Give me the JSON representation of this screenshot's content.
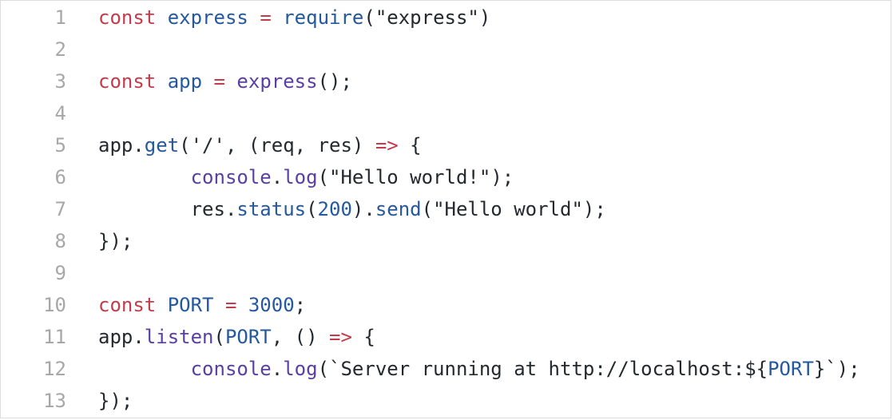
{
  "editor": {
    "lines": [
      {
        "number": "1",
        "tokens": [
          {
            "t": "kw",
            "v": "const"
          },
          {
            "t": "plain",
            "v": " "
          },
          {
            "t": "var",
            "v": "express"
          },
          {
            "t": "plain",
            "v": " "
          },
          {
            "t": "op",
            "v": "="
          },
          {
            "t": "plain",
            "v": " "
          },
          {
            "t": "var",
            "v": "require"
          },
          {
            "t": "plain",
            "v": "("
          },
          {
            "t": "str",
            "v": "\"express\""
          },
          {
            "t": "plain",
            "v": ")"
          }
        ]
      },
      {
        "number": "2",
        "tokens": []
      },
      {
        "number": "3",
        "tokens": [
          {
            "t": "kw",
            "v": "const"
          },
          {
            "t": "plain",
            "v": " "
          },
          {
            "t": "var",
            "v": "app"
          },
          {
            "t": "plain",
            "v": " "
          },
          {
            "t": "op",
            "v": "="
          },
          {
            "t": "plain",
            "v": " "
          },
          {
            "t": "func",
            "v": "express"
          },
          {
            "t": "plain",
            "v": "();"
          }
        ]
      },
      {
        "number": "4",
        "tokens": []
      },
      {
        "number": "5",
        "tokens": [
          {
            "t": "plain",
            "v": "app."
          },
          {
            "t": "prop",
            "v": "get"
          },
          {
            "t": "plain",
            "v": "("
          },
          {
            "t": "str",
            "v": "'/'"
          },
          {
            "t": "plain",
            "v": ", (req, res) "
          },
          {
            "t": "op",
            "v": "=>"
          },
          {
            "t": "plain",
            "v": " {"
          }
        ]
      },
      {
        "number": "6",
        "tokens": [
          {
            "t": "plain",
            "v": "        "
          },
          {
            "t": "func",
            "v": "console"
          },
          {
            "t": "plain",
            "v": "."
          },
          {
            "t": "func",
            "v": "log"
          },
          {
            "t": "plain",
            "v": "("
          },
          {
            "t": "str",
            "v": "\"Hello world!\""
          },
          {
            "t": "plain",
            "v": ");"
          }
        ]
      },
      {
        "number": "7",
        "tokens": [
          {
            "t": "plain",
            "v": "        res."
          },
          {
            "t": "prop",
            "v": "status"
          },
          {
            "t": "plain",
            "v": "("
          },
          {
            "t": "num",
            "v": "200"
          },
          {
            "t": "plain",
            "v": ")."
          },
          {
            "t": "prop",
            "v": "send"
          },
          {
            "t": "plain",
            "v": "("
          },
          {
            "t": "str",
            "v": "\"Hello world\""
          },
          {
            "t": "plain",
            "v": ");"
          }
        ]
      },
      {
        "number": "8",
        "tokens": [
          {
            "t": "plain",
            "v": "});"
          }
        ]
      },
      {
        "number": "9",
        "tokens": []
      },
      {
        "number": "10",
        "tokens": [
          {
            "t": "kw",
            "v": "const"
          },
          {
            "t": "plain",
            "v": " "
          },
          {
            "t": "var",
            "v": "PORT"
          },
          {
            "t": "plain",
            "v": " "
          },
          {
            "t": "op",
            "v": "="
          },
          {
            "t": "plain",
            "v": " "
          },
          {
            "t": "num",
            "v": "3000"
          },
          {
            "t": "plain",
            "v": ";"
          }
        ]
      },
      {
        "number": "11",
        "tokens": [
          {
            "t": "plain",
            "v": "app."
          },
          {
            "t": "func",
            "v": "listen"
          },
          {
            "t": "plain",
            "v": "("
          },
          {
            "t": "var",
            "v": "PORT"
          },
          {
            "t": "plain",
            "v": ", () "
          },
          {
            "t": "op",
            "v": "=>"
          },
          {
            "t": "plain",
            "v": " {"
          }
        ]
      },
      {
        "number": "12",
        "tokens": [
          {
            "t": "plain",
            "v": "        "
          },
          {
            "t": "func",
            "v": "console"
          },
          {
            "t": "plain",
            "v": "."
          },
          {
            "t": "func",
            "v": "log"
          },
          {
            "t": "plain",
            "v": "("
          },
          {
            "t": "str",
            "v": "`Server running at http://localhost:${"
          },
          {
            "t": "var",
            "v": "PORT"
          },
          {
            "t": "str",
            "v": "}`"
          },
          {
            "t": "plain",
            "v": ");"
          }
        ]
      },
      {
        "number": "13",
        "tokens": [
          {
            "t": "plain",
            "v": "});"
          }
        ]
      }
    ]
  },
  "colors": {
    "keyword": "#c43b4a",
    "variable": "#24589f",
    "function": "#5b3ea5",
    "line_number": "#a7a7a7",
    "text": "#24292e",
    "border": "#dcdcdc"
  }
}
